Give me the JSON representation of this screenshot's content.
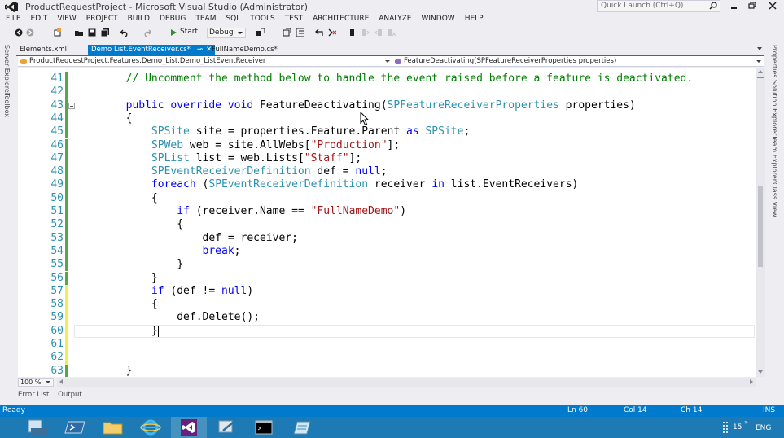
{
  "window": {
    "title": "ProductRequestProject - Microsoft Visual Studio (Administrator)",
    "quick_launch_placeholder": "Quick Launch (Ctrl+Q)"
  },
  "menu": [
    "FILE",
    "EDIT",
    "VIEW",
    "PROJECT",
    "BUILD",
    "DEBUG",
    "TEAM",
    "SQL",
    "TOOLS",
    "TEST",
    "ARCHITECTURE",
    "ANALYZE",
    "WINDOW",
    "HELP"
  ],
  "toolbar": {
    "start_label": "Start",
    "config_value": "Debug"
  },
  "left_tool_tabs": [
    "Server Explorer",
    "Toolbox"
  ],
  "right_tool_tabs": [
    "Properties",
    "Solution Explorer",
    "Team Explorer",
    "Class View"
  ],
  "doc_tabs": [
    {
      "label": "Elements.xml",
      "active": false
    },
    {
      "label": "Demo List.EventReceiver.cs*",
      "active": true
    },
    {
      "label": "FullNameDemo.cs*",
      "active": false
    }
  ],
  "navbar": {
    "type_combo": "ProductRequestProject.Features.Demo_List.Demo_ListEventReceiver",
    "member_combo": "FeatureDeactivating(SPFeatureReceiverProperties properties)"
  },
  "editor": {
    "lines": [
      {
        "n": "41",
        "chg": "green",
        "segs": [
          [
            "c",
            "        // Uncomment the method below to handle the event raised before a feature is deactivated."
          ]
        ]
      },
      {
        "n": "42",
        "chg": "green",
        "segs": []
      },
      {
        "n": "43",
        "chg": "green",
        "collapse": true,
        "segs": [
          [
            "k",
            "        public override void "
          ],
          [
            "p",
            "FeatureDeactivating("
          ],
          [
            "t",
            "SPFeatureReceiverProperties"
          ],
          [
            "p",
            " properties)"
          ]
        ]
      },
      {
        "n": "44",
        "chg": "green",
        "segs": [
          [
            "p",
            "        {"
          ]
        ]
      },
      {
        "n": "45",
        "chg": "green",
        "segs": [
          [
            "t",
            "            SPSite"
          ],
          [
            "p",
            " site = properties.Feature.Parent "
          ],
          [
            "k",
            "as"
          ],
          [
            "p",
            " "
          ],
          [
            "t",
            "SPSite"
          ],
          [
            "p",
            ";"
          ]
        ]
      },
      {
        "n": "46",
        "chg": "green",
        "segs": [
          [
            "t",
            "            SPWeb"
          ],
          [
            "p",
            " web = site.AllWebs["
          ],
          [
            "s",
            "\"Production\""
          ],
          [
            "p",
            "];"
          ]
        ]
      },
      {
        "n": "47",
        "chg": "green",
        "segs": [
          [
            "t",
            "            SPList"
          ],
          [
            "p",
            " list = web.Lists["
          ],
          [
            "s",
            "\"Staff\""
          ],
          [
            "p",
            "];"
          ]
        ]
      },
      {
        "n": "48",
        "chg": "green",
        "segs": [
          [
            "t",
            "            SPEventReceiverDefinition"
          ],
          [
            "p",
            " def = "
          ],
          [
            "k",
            "null"
          ],
          [
            "p",
            ";"
          ]
        ]
      },
      {
        "n": "49",
        "chg": "green",
        "segs": [
          [
            "k",
            "            foreach"
          ],
          [
            "p",
            " ("
          ],
          [
            "t",
            "SPEventReceiverDefinition"
          ],
          [
            "p",
            " receiver "
          ],
          [
            "k",
            "in"
          ],
          [
            "p",
            " list.EventReceivers)"
          ]
        ]
      },
      {
        "n": "50",
        "chg": "green",
        "segs": [
          [
            "p",
            "            {"
          ]
        ]
      },
      {
        "n": "51",
        "chg": "green",
        "segs": [
          [
            "k",
            "                if"
          ],
          [
            "p",
            " (receiver.Name == "
          ],
          [
            "s",
            "\"FullNameDemo\""
          ],
          [
            "p",
            ")"
          ]
        ]
      },
      {
        "n": "52",
        "chg": "green",
        "segs": [
          [
            "p",
            "                {"
          ]
        ]
      },
      {
        "n": "53",
        "chg": "green",
        "segs": [
          [
            "p",
            "                    def = receiver;"
          ]
        ]
      },
      {
        "n": "54",
        "chg": "green",
        "segs": [
          [
            "k",
            "                    break"
          ],
          [
            "p",
            ";"
          ]
        ]
      },
      {
        "n": "55",
        "chg": "green",
        "segs": [
          [
            "p",
            "                }"
          ]
        ]
      },
      {
        "n": "56",
        "chg": "green",
        "segs": [
          [
            "p",
            "            }"
          ]
        ]
      },
      {
        "n": "57",
        "chg": "yellow",
        "segs": [
          [
            "k",
            "            if"
          ],
          [
            "p",
            " (def != "
          ],
          [
            "k",
            "null"
          ],
          [
            "p",
            ")"
          ]
        ]
      },
      {
        "n": "58",
        "chg": "yellow",
        "segs": [
          [
            "p",
            "            {"
          ]
        ]
      },
      {
        "n": "59",
        "chg": "yellow",
        "segs": [
          [
            "p",
            "                def.Delete();"
          ]
        ]
      },
      {
        "n": "60",
        "chg": "yellow",
        "current": true,
        "segs": [
          [
            "p",
            "            }"
          ]
        ]
      },
      {
        "n": "61",
        "chg": "yellow",
        "segs": []
      },
      {
        "n": "62",
        "chg": "yellow",
        "segs": []
      },
      {
        "n": "63",
        "chg": "green",
        "segs": [
          [
            "p",
            "        }"
          ]
        ]
      }
    ]
  },
  "zoom": "100 %",
  "bottom_tool_tabs": [
    "Error List",
    "Output"
  ],
  "status": {
    "ready": "Ready",
    "ln": "Ln 60",
    "col": "Col 14",
    "ch": "Ch 14",
    "mode": "INS"
  },
  "taskbar": {
    "apps": [
      "server-manager",
      "powershell",
      "file-explorer",
      "internet-explorer",
      "visual-studio",
      "sharepoint-config",
      "command-prompt",
      "notepad"
    ],
    "active_app": "visual-studio",
    "tray_count": "15",
    "language": "ENG"
  },
  "colors": {
    "accent": "#007acc",
    "keyword": "#0000ff",
    "type": "#2b91af",
    "string": "#a31515",
    "comment": "#008000",
    "taskbar": "#1d7ab4"
  }
}
